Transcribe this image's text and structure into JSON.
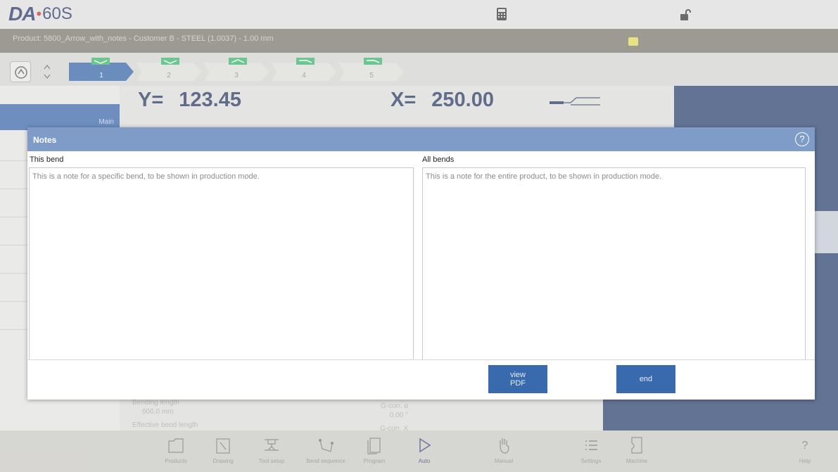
{
  "app": {
    "logo_brand": "DA",
    "logo_dot": "•",
    "logo_model": "60S"
  },
  "product_bar": {
    "text": "Product: 5800_Arrow_with_notes - Customer B - STEEL (1.0037) - 1.00 mm"
  },
  "bends": {
    "steps": [
      {
        "number": "1",
        "active": true
      },
      {
        "number": "2",
        "active": false
      },
      {
        "number": "3",
        "active": false
      },
      {
        "number": "4",
        "active": false
      },
      {
        "number": "5",
        "active": false
      }
    ]
  },
  "left_menu": {
    "main_label": "Main"
  },
  "readouts": {
    "y_label": "Y=",
    "y_value": "123.45",
    "x_label": "X=",
    "x_value": "250.00"
  },
  "lower_info": {
    "bending_length_label": "Bending length",
    "bending_length_value": "600.0 mm",
    "effective_label": "Effective bend length",
    "gcorr_a_label": "G-corr. α",
    "gcorr_a_value": "0.00 °",
    "gcorr_x_label": "G-corr. X"
  },
  "nav": {
    "items": [
      {
        "label": "Products",
        "icon": "folder-icon"
      },
      {
        "label": "Drawing",
        "icon": "pencil-icon"
      },
      {
        "label": "Tool setup",
        "icon": "tool-setup-icon"
      },
      {
        "label": "Bend sequence",
        "icon": "bend-sequence-icon"
      },
      {
        "label": "Program",
        "icon": "program-icon"
      },
      {
        "label": "Auto",
        "icon": "play-icon"
      },
      {
        "label": "Manual",
        "icon": "hand-icon"
      },
      {
        "label": "Settings",
        "icon": "list-icon"
      },
      {
        "label": "Machine",
        "icon": "machine-icon"
      },
      {
        "label": "Help",
        "icon": "help-icon"
      }
    ]
  },
  "dialog": {
    "title": "Notes",
    "help_glyph": "?",
    "this_bend_label": "This bend",
    "this_bend_note": "This is a note for a specific bend, to be shown in production mode.",
    "all_bends_label": "All bends",
    "all_bends_note": "This is a note for the entire product, to be shown in production mode.",
    "view_pdf_label_line1": "view",
    "view_pdf_label_line2": "PDF",
    "end_label": "end"
  },
  "colors": {
    "accent_blue": "#3a6aae",
    "dialog_header": "#7f9cc8",
    "readout_text": "#2a3d63",
    "bend_glyph_green": "#3bb46a"
  }
}
